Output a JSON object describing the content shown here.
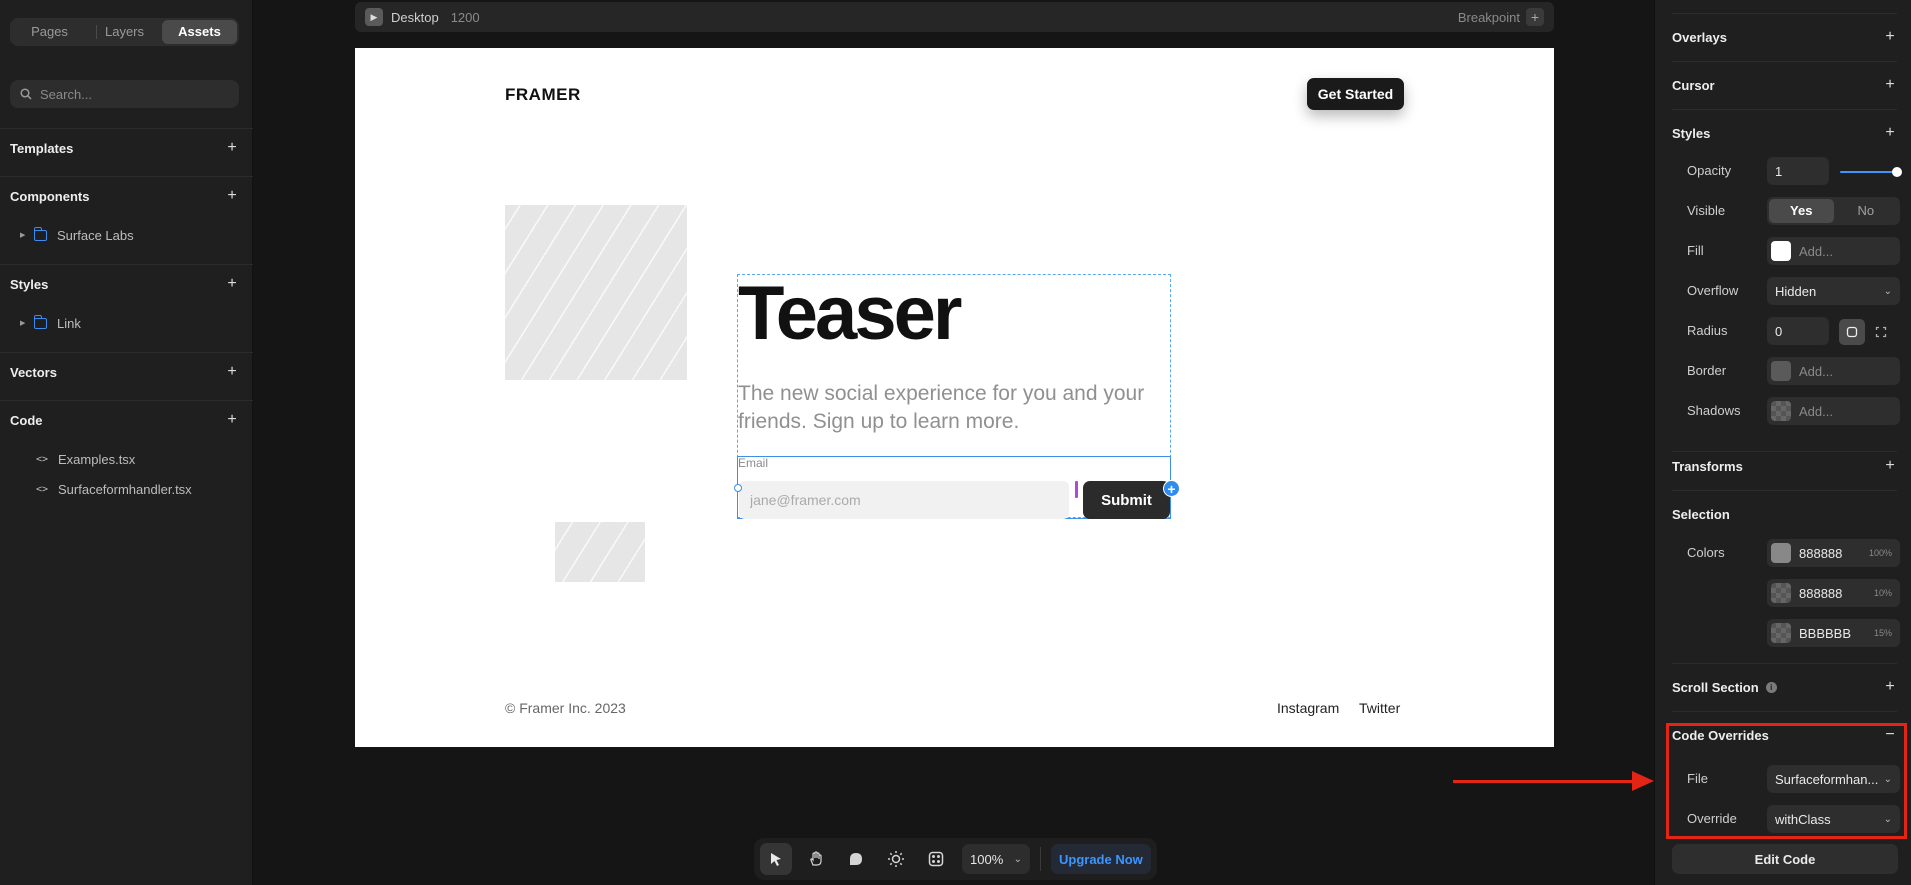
{
  "left_panel": {
    "tabs": [
      {
        "label": "Pages"
      },
      {
        "label": "Layers"
      },
      {
        "label": "Assets"
      }
    ],
    "search_placeholder": "Search...",
    "sections": {
      "templates": "Templates",
      "components": "Components",
      "styles": "Styles",
      "vectors": "Vectors",
      "code": "Code"
    },
    "components_items": [
      "Surface Labs"
    ],
    "styles_items": [
      "Link"
    ],
    "code_files": [
      "Examples.tsx",
      "Surfaceformhandler.tsx"
    ]
  },
  "canvas": {
    "breakpoint_name": "Desktop",
    "breakpoint_width": "1200",
    "breakpoint_label": "Breakpoint",
    "site": {
      "logo": "FRAMER",
      "cta": "Get Started",
      "heading": "Teaser",
      "subheading": "The new social experience for you and your friends. Sign up to learn more.",
      "email_label": "Email",
      "email_placeholder": "jane@framer.com",
      "submit_label": "Submit",
      "copyright": "© Framer Inc. 2023",
      "footer_links": [
        "Instagram",
        "Twitter"
      ]
    }
  },
  "toolbar": {
    "zoom": "100%",
    "upgrade": "Upgrade Now",
    "tools": [
      "select-tool",
      "hand-tool",
      "comment-tool",
      "theme-tool",
      "plugins-tool"
    ]
  },
  "right_panel": {
    "sections": {
      "overlays": "Overlays",
      "cursor": "Cursor",
      "styles": "Styles",
      "transforms": "Transforms",
      "selection": "Selection",
      "scroll_section": "Scroll Section",
      "code_overrides": "Code Overrides"
    },
    "opacity": {
      "label": "Opacity",
      "value": "1",
      "level": 1
    },
    "visible": {
      "label": "Visible",
      "yes": "Yes",
      "no": "No",
      "selected": "Yes"
    },
    "fill": {
      "label": "Fill",
      "placeholder": "Add...",
      "color": "#ffffff"
    },
    "overflow": {
      "label": "Overflow",
      "value": "Hidden"
    },
    "radius": {
      "label": "Radius",
      "value": "0"
    },
    "border": {
      "label": "Border",
      "placeholder": "Add..."
    },
    "shadows": {
      "label": "Shadows",
      "placeholder": "Add..."
    },
    "colors": {
      "label": "Colors",
      "items": [
        {
          "hex": "888888",
          "opacity": "100%",
          "color": "#888888"
        },
        {
          "hex": "888888",
          "opacity": "10%",
          "color": "#888888"
        },
        {
          "hex": "BBBBBB",
          "opacity": "15%",
          "color": "#bbbbbb"
        }
      ]
    },
    "code_overrides": {
      "file_label": "File",
      "file_value": "Surfaceformhan...",
      "override_label": "Override",
      "override_value": "withClass",
      "edit_button": "Edit Code"
    }
  },
  "annotation": {
    "highlight_color": "#e42414"
  }
}
